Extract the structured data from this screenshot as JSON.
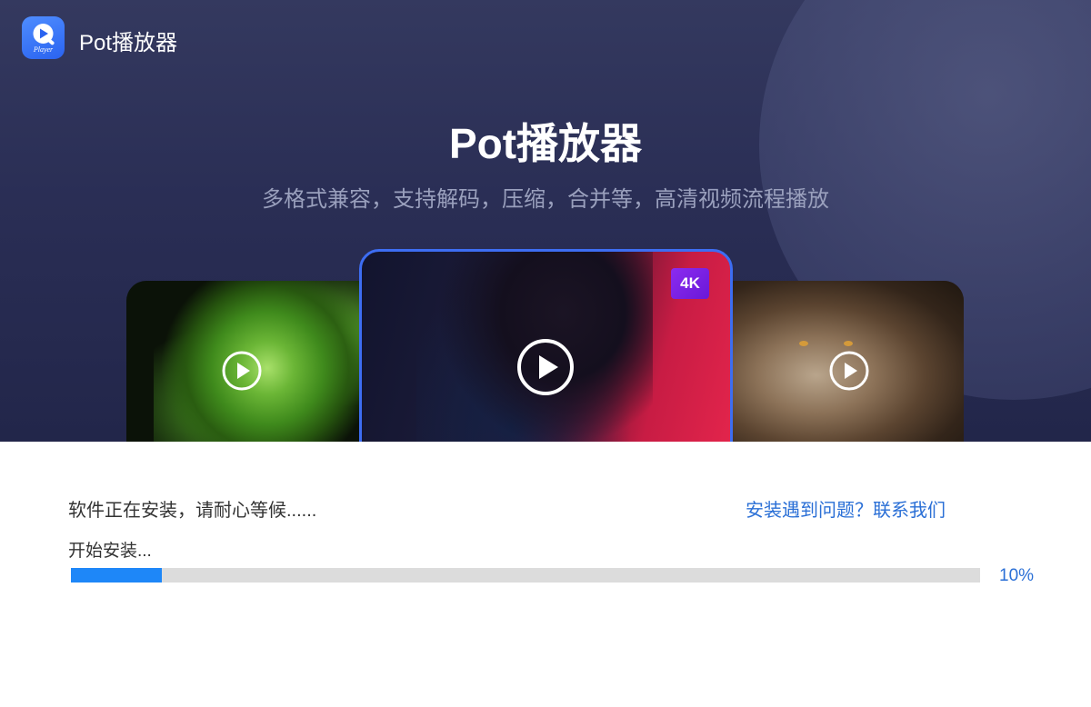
{
  "header": {
    "app_name": "Pot播放器",
    "logo_text": "Player",
    "logo_icon": "player-logo-icon"
  },
  "hero": {
    "title": "Pot播放器",
    "subtitle": "多格式兼容，支持解码，压缩，合并等，高清视频流程播放"
  },
  "cards": [
    {
      "subject": "lettuce",
      "icon": "play-icon"
    },
    {
      "subject": "portrait",
      "icon": "play-icon",
      "badge": "4K"
    },
    {
      "subject": "lion",
      "icon": "play-icon"
    }
  ],
  "install": {
    "status_text": "软件正在安装，请耐心等候......",
    "help_link": "安装遇到问题？联系我们",
    "step_text": "开始安装...",
    "progress_percent": 10,
    "progress_label": "10%"
  },
  "colors": {
    "accent": "#1e87f8",
    "link": "#2a6fd6",
    "hero_bg": "#2a2e55",
    "badge": "#7b22e6"
  }
}
